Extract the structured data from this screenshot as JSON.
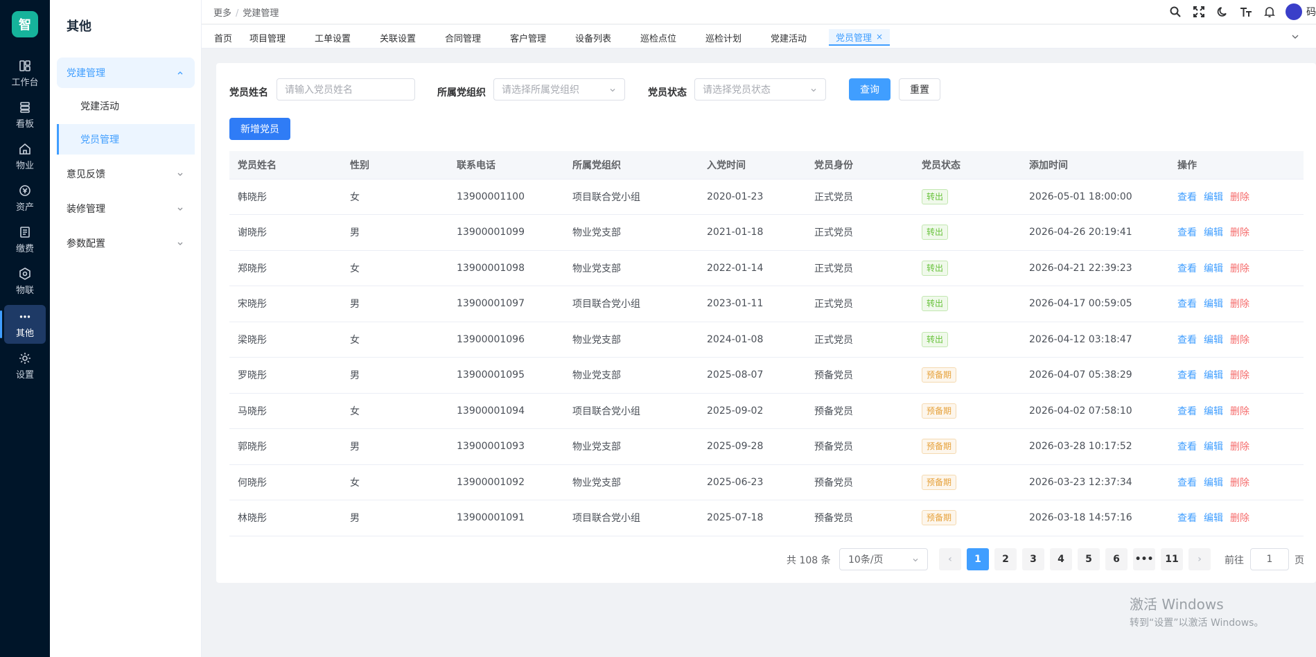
{
  "rail": {
    "logo": "智",
    "items": [
      {
        "label": "工作台",
        "icon": "dashboard-icon"
      },
      {
        "label": "看板",
        "icon": "board-icon"
      },
      {
        "label": "物业",
        "icon": "home-icon"
      },
      {
        "label": "资产",
        "icon": "coin-icon"
      },
      {
        "label": "缴费",
        "icon": "bill-icon"
      },
      {
        "label": "物联",
        "icon": "hexagon-icon"
      },
      {
        "label": "其他",
        "icon": "more-icon"
      },
      {
        "label": "设置",
        "icon": "gear-icon"
      }
    ]
  },
  "sidebar": {
    "title": "其他",
    "groups": [
      {
        "label": "党建管理",
        "open": true,
        "children": [
          {
            "label": "党建活动"
          },
          {
            "label": "党员管理",
            "active": true
          }
        ]
      },
      {
        "label": "意见反馈"
      },
      {
        "label": "装修管理"
      },
      {
        "label": "参数配置"
      }
    ]
  },
  "header": {
    "breadcrumb": [
      "更多",
      "党建管理"
    ],
    "separator": "/",
    "user_name": "码"
  },
  "tabs": [
    {
      "label": "首页"
    },
    {
      "label": "项目管理"
    },
    {
      "label": "工单设置"
    },
    {
      "label": "关联设置"
    },
    {
      "label": "合同管理"
    },
    {
      "label": "客户管理"
    },
    {
      "label": "设备列表"
    },
    {
      "label": "巡检点位"
    },
    {
      "label": "巡检计划"
    },
    {
      "label": "党建活动"
    },
    {
      "label": "党员管理",
      "active": true,
      "close": "×"
    }
  ],
  "filters": {
    "name_label": "党员姓名",
    "name_placeholder": "请输入党员姓名",
    "org_label": "所属党组织",
    "org_placeholder": "请选择所属党组织",
    "status_label": "党员状态",
    "status_placeholder": "请选择党员状态",
    "query_btn": "查询",
    "reset_btn": "重置",
    "add_btn": "新增党员"
  },
  "table": {
    "columns": [
      "党员姓名",
      "性别",
      "联系电话",
      "所属党组织",
      "入党时间",
      "党员身份",
      "党员状态",
      "添加时间",
      "操作"
    ],
    "actions": {
      "view": "查看",
      "edit": "编辑",
      "delete": "删除"
    },
    "rows": [
      {
        "name": "韩晓彤",
        "gender": "女",
        "phone": "13900001100",
        "org": "项目联合党小组",
        "join": "2020-01-23",
        "identity": "正式党员",
        "status": "转出",
        "status_type": "out",
        "added": "2026-05-01 18:00:00"
      },
      {
        "name": "谢晓彤",
        "gender": "男",
        "phone": "13900001099",
        "org": "物业党支部",
        "join": "2021-01-18",
        "identity": "正式党员",
        "status": "转出",
        "status_type": "out",
        "added": "2026-04-26 20:19:41"
      },
      {
        "name": "郑晓彤",
        "gender": "女",
        "phone": "13900001098",
        "org": "物业党支部",
        "join": "2022-01-14",
        "identity": "正式党员",
        "status": "转出",
        "status_type": "out",
        "added": "2026-04-21 22:39:23"
      },
      {
        "name": "宋晓彤",
        "gender": "男",
        "phone": "13900001097",
        "org": "项目联合党小组",
        "join": "2023-01-11",
        "identity": "正式党员",
        "status": "转出",
        "status_type": "out",
        "added": "2026-04-17 00:59:05"
      },
      {
        "name": "梁晓彤",
        "gender": "女",
        "phone": "13900001096",
        "org": "物业党支部",
        "join": "2024-01-08",
        "identity": "正式党员",
        "status": "转出",
        "status_type": "out",
        "added": "2026-04-12 03:18:47"
      },
      {
        "name": "罗晓彤",
        "gender": "男",
        "phone": "13900001095",
        "org": "物业党支部",
        "join": "2025-08-07",
        "identity": "预备党员",
        "status": "预备期",
        "status_type": "pre",
        "added": "2026-04-07 05:38:29"
      },
      {
        "name": "马晓彤",
        "gender": "女",
        "phone": "13900001094",
        "org": "项目联合党小组",
        "join": "2025-09-02",
        "identity": "预备党员",
        "status": "预备期",
        "status_type": "pre",
        "added": "2026-04-02 07:58:10"
      },
      {
        "name": "郭晓彤",
        "gender": "男",
        "phone": "13900001093",
        "org": "物业党支部",
        "join": "2025-09-28",
        "identity": "预备党员",
        "status": "预备期",
        "status_type": "pre",
        "added": "2026-03-28 10:17:52"
      },
      {
        "name": "何晓彤",
        "gender": "女",
        "phone": "13900001092",
        "org": "物业党支部",
        "join": "2025-06-23",
        "identity": "预备党员",
        "status": "预备期",
        "status_type": "pre",
        "added": "2026-03-23 12:37:34"
      },
      {
        "name": "林晓彤",
        "gender": "男",
        "phone": "13900001091",
        "org": "项目联合党小组",
        "join": "2025-07-18",
        "identity": "预备党员",
        "status": "预备期",
        "status_type": "pre",
        "added": "2026-03-18 14:57:16"
      }
    ]
  },
  "pagination": {
    "total_text": "共 108 条",
    "page_size": "10条/页",
    "pages": [
      "1",
      "2",
      "3",
      "4",
      "5",
      "6",
      "•••",
      "11"
    ],
    "current": "1",
    "prev": "‹",
    "next": "›",
    "goto_prefix": "前往",
    "goto_value": "1",
    "goto_suffix": "页"
  },
  "watermark": {
    "line1": "激活 Windows",
    "line2": "转到“设置”以激活 Windows。"
  },
  "colors": {
    "primary": "#409eff",
    "rail_bg": "#001529",
    "success": "#67c23a",
    "warning": "#e6a23c",
    "danger": "#f56c6c"
  }
}
